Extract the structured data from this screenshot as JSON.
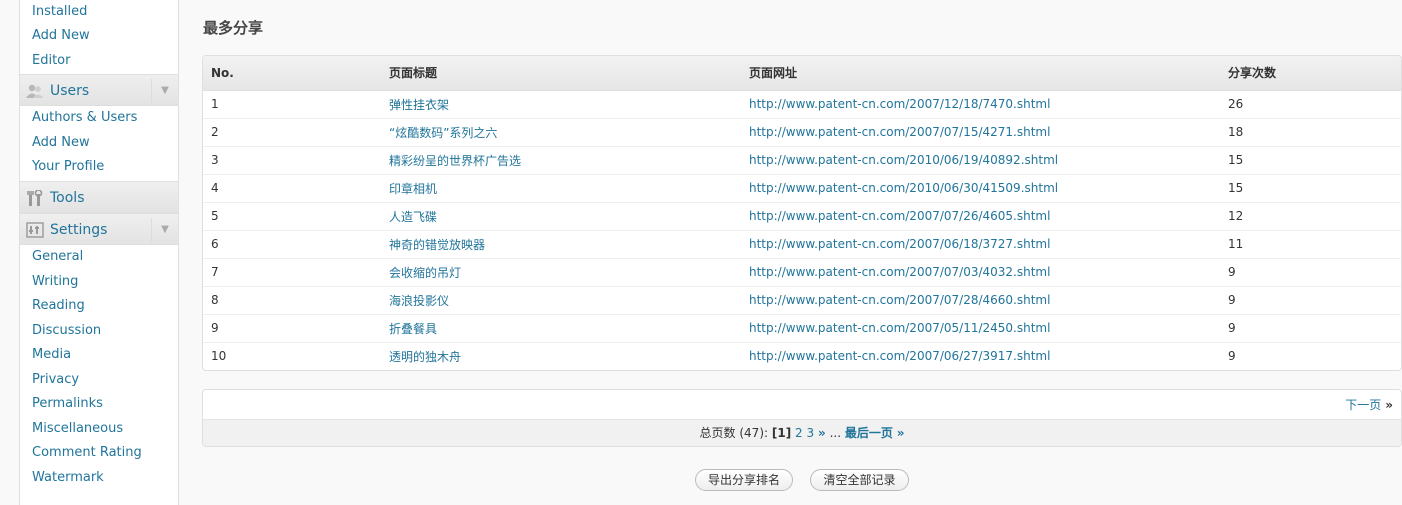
{
  "sidebar": {
    "top_items": [
      {
        "label": "Installed"
      },
      {
        "label": "Add New"
      },
      {
        "label": "Editor"
      }
    ],
    "users": {
      "label": "Users",
      "items": [
        {
          "label": "Authors & Users"
        },
        {
          "label": "Add New"
        },
        {
          "label": "Your Profile"
        }
      ]
    },
    "tools": {
      "label": "Tools"
    },
    "settings": {
      "label": "Settings",
      "items": [
        {
          "label": "General"
        },
        {
          "label": "Writing"
        },
        {
          "label": "Reading"
        },
        {
          "label": "Discussion"
        },
        {
          "label": "Media"
        },
        {
          "label": "Privacy"
        },
        {
          "label": "Permalinks"
        },
        {
          "label": "Miscellaneous"
        },
        {
          "label": "Comment Rating"
        },
        {
          "label": "Watermark"
        }
      ]
    }
  },
  "main": {
    "title": "最多分享",
    "table": {
      "headers": {
        "no": "No.",
        "title": "页面标题",
        "url": "页面网址",
        "count": "分享次数"
      },
      "rows": [
        {
          "no": "1",
          "title": "弹性挂衣架",
          "url": "http://www.patent-cn.com/2007/12/18/7470.shtml",
          "count": "26"
        },
        {
          "no": "2",
          "title": "“炫酷数码”系列之六",
          "url": "http://www.patent-cn.com/2007/07/15/4271.shtml",
          "count": "18"
        },
        {
          "no": "3",
          "title": "精彩纷呈的世界杯广告选",
          "url": "http://www.patent-cn.com/2010/06/19/40892.shtml",
          "count": "15"
        },
        {
          "no": "4",
          "title": "印章相机",
          "url": "http://www.patent-cn.com/2010/06/30/41509.shtml",
          "count": "15"
        },
        {
          "no": "5",
          "title": "人造飞碟",
          "url": "http://www.patent-cn.com/2007/07/26/4605.shtml",
          "count": "12"
        },
        {
          "no": "6",
          "title": "神奇的错觉放映器",
          "url": "http://www.patent-cn.com/2007/06/18/3727.shtml",
          "count": "11"
        },
        {
          "no": "7",
          "title": "会收缩的吊灯",
          "url": "http://www.patent-cn.com/2007/07/03/4032.shtml",
          "count": "9"
        },
        {
          "no": "8",
          "title": "海浪投影仪",
          "url": "http://www.patent-cn.com/2007/07/28/4660.shtml",
          "count": "9"
        },
        {
          "no": "9",
          "title": "折叠餐具",
          "url": "http://www.patent-cn.com/2007/05/11/2450.shtml",
          "count": "9"
        },
        {
          "no": "10",
          "title": "透明的独木舟",
          "url": "http://www.patent-cn.com/2007/06/27/3917.shtml",
          "count": "9"
        }
      ]
    },
    "pager": {
      "next_label": "下一页",
      "next_arrow": "»",
      "total_label": "总页数 (47):",
      "current_page": "[1]",
      "pages": [
        "2",
        "3"
      ],
      "more_arrow": "»",
      "ellipsis": "...",
      "last_label": "最后一页",
      "last_arrow": "»"
    },
    "buttons": {
      "export": "导出分享排名",
      "clear": "清空全部记录"
    }
  },
  "colors": {
    "link": "#21759b",
    "background": "#f9f9f9"
  },
  "icons": {
    "users": "users-icon",
    "tools": "tools-icon",
    "settings": "settings-icon",
    "toggle": "chevron-down-icon"
  }
}
